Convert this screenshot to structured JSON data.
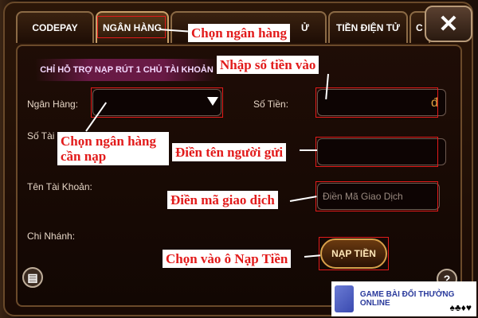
{
  "tabs": [
    {
      "label": "CODEPAY"
    },
    {
      "label": "NGÂN HÀNG"
    },
    {
      "label": "Ử"
    },
    {
      "label": "TIỀN ĐIỆN TỬ"
    },
    {
      "label": "C"
    }
  ],
  "close_label": "✕",
  "banner": "CHỈ HỖ TRỢ NẠP RÚT 1 CHỦ TÀI KHOẢN",
  "form": {
    "bank_label": "Ngân Hàng:",
    "account_number_label": "Số Tài K",
    "account_name_label": "Tên Tài Khoản:",
    "branch_label": "Chi Nhánh:",
    "amount_label": "Số Tiền:",
    "amount_currency": "đ",
    "transaction_code_placeholder": "Điền Mã Giao Dịch",
    "submit_label": "NẠP TIỀN"
  },
  "annotations": {
    "choose_bank_tab": "Chọn ngân hàng",
    "enter_amount": "Nhập số tiền vào",
    "choose_bank_line1": "Chọn ngân hàng",
    "choose_bank_line2": "cần nạp",
    "sender_name": "Điền tên người gửi",
    "transaction_code": "Điền mã giao dịch",
    "click_deposit": "Chọn vào ô Nạp Tiền"
  },
  "help_label": "?",
  "logo": {
    "text": "GAME BÀI ĐỔI THƯỞNG ONLINE",
    "suits": "♠♣♦♥"
  },
  "colors": {
    "annotation_red": "#e21b1b",
    "submit_gold": "#d7a04a",
    "banner_purple": "#821e5a"
  }
}
